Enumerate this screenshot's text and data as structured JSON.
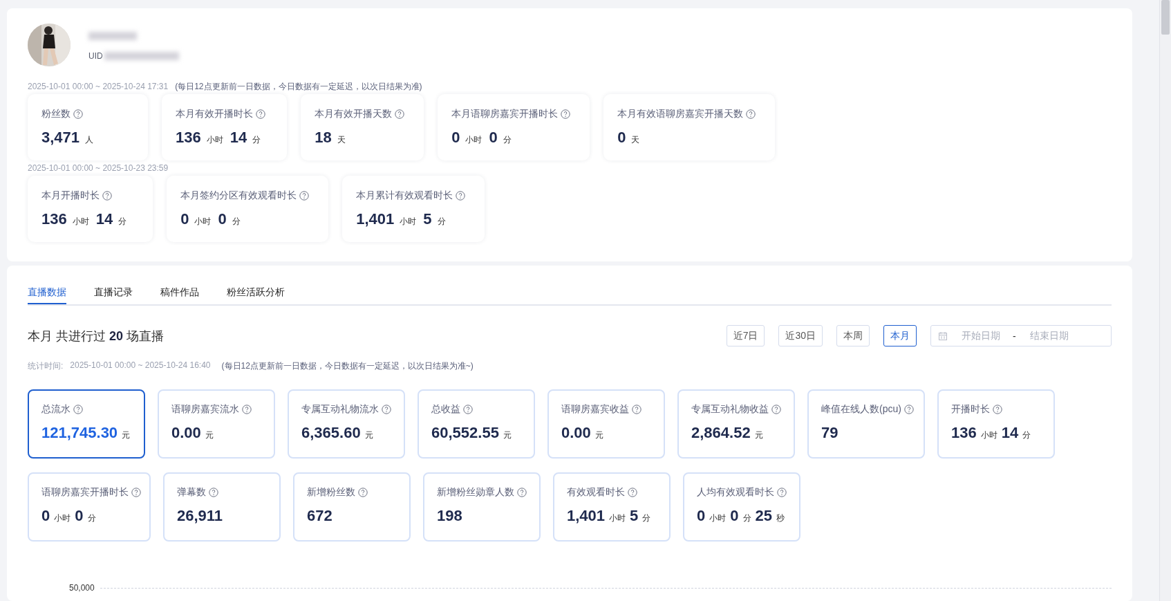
{
  "profile": {
    "uid_label": "UID"
  },
  "overview_groups": [
    {
      "period": "2025-10-01 00:00 ~ 2025-10-24 17:31",
      "note": "(每日12点更新前一日数据，今日数据有一定延迟，以次日结果为准)",
      "cards": [
        {
          "label": "粉丝数",
          "parts": [
            {
              "num": "3,471",
              "unit": "人"
            }
          ]
        },
        {
          "label": "本月有效开播时长",
          "parts": [
            {
              "num": "136",
              "unit": "小时"
            },
            {
              "num": "14",
              "unit": "分"
            }
          ]
        },
        {
          "label": "本月有效开播天数",
          "parts": [
            {
              "num": "18",
              "unit": "天"
            }
          ]
        },
        {
          "label": "本月语聊房嘉宾开播时长",
          "parts": [
            {
              "num": "0",
              "unit": "小时"
            },
            {
              "num": "0",
              "unit": "分"
            }
          ]
        },
        {
          "label": "本月有效语聊房嘉宾开播天数",
          "parts": [
            {
              "num": "0",
              "unit": "天"
            }
          ]
        }
      ]
    },
    {
      "period": "2025-10-01 00:00 ~ 2025-10-23 23:59",
      "cards": [
        {
          "label": "本月开播时长",
          "parts": [
            {
              "num": "136",
              "unit": "小时"
            },
            {
              "num": "14",
              "unit": "分"
            }
          ]
        },
        {
          "label": "本月签约分区有效观看时长",
          "parts": [
            {
              "num": "0",
              "unit": "小时"
            },
            {
              "num": "0",
              "unit": "分"
            }
          ]
        },
        {
          "label": "本月累计有效观看时长",
          "parts": [
            {
              "num": "1,401",
              "unit": "小时"
            },
            {
              "num": "5",
              "unit": "分"
            }
          ]
        }
      ]
    }
  ],
  "tabs": [
    {
      "label": "直播数据",
      "selected": true
    },
    {
      "label": "直播记录",
      "selected": false
    },
    {
      "label": "稿件作品",
      "selected": false
    },
    {
      "label": "粉丝活跃分析",
      "selected": false
    }
  ],
  "summary": {
    "period": "本月",
    "text_before": "共进行过",
    "count": "20",
    "text_after": "场直播"
  },
  "range_buttons": [
    {
      "label": "近7日",
      "selected": false
    },
    {
      "label": "近30日",
      "selected": false
    },
    {
      "label": "本周",
      "selected": false
    },
    {
      "label": "本月",
      "selected": true
    }
  ],
  "date_range": {
    "start_placeholder": "开始日期",
    "separator": "-",
    "end_placeholder": "结束日期"
  },
  "stat_time": {
    "label": "统计时间:",
    "period": "2025-10-01 00:00 ~ 2025-10-24 16:40",
    "note": "(每日12点更新前一日数据，今日数据有一定延迟，以次日结果为准~)"
  },
  "metrics": [
    {
      "label": "总流水",
      "selected": true,
      "parts": [
        {
          "num": "121,745.30",
          "unit": "元"
        }
      ]
    },
    {
      "label": "语聊房嘉宾流水",
      "selected": false,
      "parts": [
        {
          "num": "0.00",
          "unit": "元"
        }
      ]
    },
    {
      "label": "专属互动礼物流水",
      "selected": false,
      "parts": [
        {
          "num": "6,365.60",
          "unit": "元"
        }
      ]
    },
    {
      "label": "总收益",
      "selected": false,
      "parts": [
        {
          "num": "60,552.55",
          "unit": "元"
        }
      ]
    },
    {
      "label": "语聊房嘉宾收益",
      "selected": false,
      "parts": [
        {
          "num": "0.00",
          "unit": "元"
        }
      ]
    },
    {
      "label": "专属互动礼物收益",
      "selected": false,
      "parts": [
        {
          "num": "2,864.52",
          "unit": "元"
        }
      ]
    },
    {
      "label": "峰值在线人数(pcu)",
      "selected": false,
      "parts": [
        {
          "num": "79"
        }
      ]
    },
    {
      "label": "开播时长",
      "selected": false,
      "parts": [
        {
          "num": "136",
          "unit": "小时"
        },
        {
          "num": "14",
          "unit": "分"
        }
      ]
    },
    {
      "label": "语聊房嘉宾开播时长",
      "selected": false,
      "parts": [
        {
          "num": "0",
          "unit": "小时"
        },
        {
          "num": "0",
          "unit": "分"
        }
      ]
    },
    {
      "label": "弹幕数",
      "selected": false,
      "parts": [
        {
          "num": "26,911"
        }
      ]
    },
    {
      "label": "新增粉丝数",
      "selected": false,
      "parts": [
        {
          "num": "672"
        }
      ]
    },
    {
      "label": "新增粉丝勋章人数",
      "selected": false,
      "parts": [
        {
          "num": "198"
        }
      ]
    },
    {
      "label": "有效观看时长",
      "selected": false,
      "parts": [
        {
          "num": "1,401",
          "unit": "小时"
        },
        {
          "num": "5",
          "unit": "分"
        }
      ]
    },
    {
      "label": "人均有效观看时长",
      "selected": false,
      "parts": [
        {
          "num": "0",
          "unit": "小时"
        },
        {
          "num": "0",
          "unit": "分"
        },
        {
          "num": "25",
          "unit": "秒"
        }
      ]
    }
  ],
  "chart": {
    "top_tick": "50,000"
  }
}
